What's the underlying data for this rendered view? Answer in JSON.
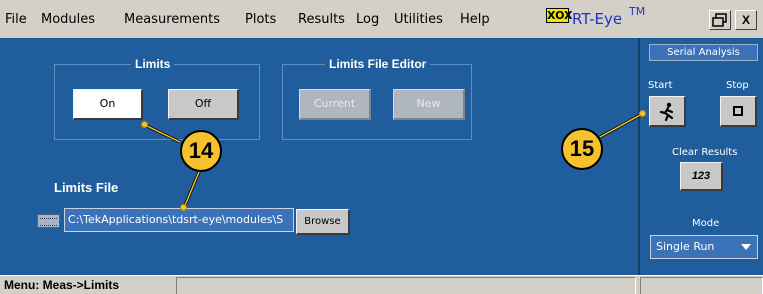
{
  "menubar": {
    "items": [
      "File",
      "Modules",
      "Measurements",
      "Plots",
      "Results",
      "Log",
      "Utilities",
      "Help"
    ],
    "logo": {
      "box_text": "XOX",
      "name": "RT-Eye",
      "trademark": "TM"
    },
    "window_buttons": {
      "restore_icon": "restore-window-icon",
      "close_icon": "close-icon",
      "close_glyph": "X"
    }
  },
  "limits": {
    "group_title": "Limits",
    "on_label": "On",
    "off_label": "Off",
    "selected": "On"
  },
  "editor": {
    "group_title": "Limits File Editor",
    "current_label": "Current",
    "new_label": "New"
  },
  "limits_file": {
    "label": "Limits File",
    "path": "C:\\TekApplications\\tdsrt-eye\\modules\\S",
    "browse_label": "Browse"
  },
  "serial_analysis": {
    "title": "Serial Analysis",
    "start_label": "Start",
    "stop_label": "Stop",
    "clear_results_label": "Clear Results",
    "clear_icon_text": "123",
    "mode_label": "Mode",
    "mode_value": "Single Run"
  },
  "status": {
    "menu_path": "Menu: Meas->Limits"
  },
  "callouts": [
    "14",
    "15"
  ],
  "colors": {
    "panel_blue": "#1f5d9c",
    "field_blue": "#3c73b8",
    "callout_yellow": "#f5c12f",
    "chrome_gray": "#d4d0c8"
  }
}
